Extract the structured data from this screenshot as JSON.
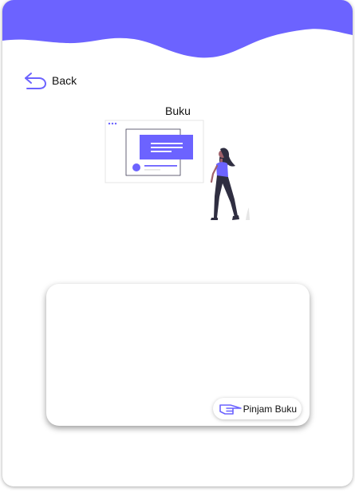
{
  "header": {
    "back_label": "Back",
    "title": "Buku"
  },
  "card": {
    "action_label": "Pinjam Buku"
  },
  "icons": {
    "back": "back-arrow-icon",
    "action": "hand-icon"
  },
  "colors": {
    "accent": "#6c63ff",
    "header_wave": "#6c63ff",
    "text": "#111111",
    "figure_dark": "#2f2e41"
  }
}
